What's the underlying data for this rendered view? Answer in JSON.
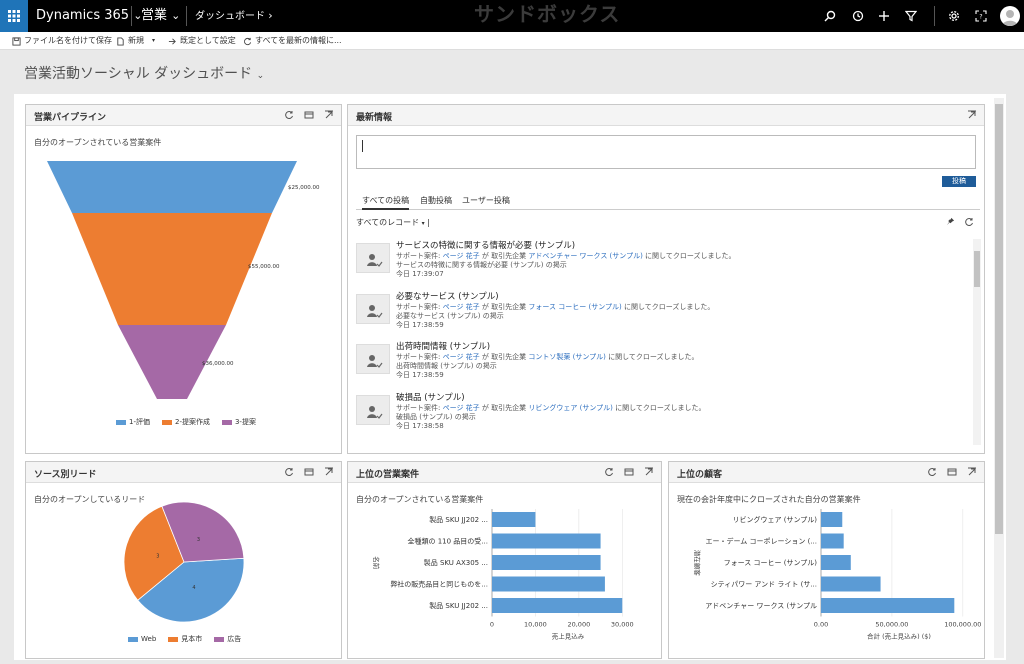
{
  "header": {
    "brand": "Dynamics 365",
    "area": "営業",
    "breadcrumb": "ダッシュボード",
    "watermark": "サンドボックス"
  },
  "commands": [
    {
      "label": "ファイル名を付けて保存",
      "icon": "save-icon"
    },
    {
      "label": "新規",
      "icon": "new-icon"
    },
    {
      "label": "既定として設定",
      "icon": "pin-default-icon"
    },
    {
      "label": "すべてを最新の情報に...",
      "icon": "refresh-icon"
    }
  ],
  "dashboard": {
    "title": "営業活動ソーシャル ダッシュボード"
  },
  "pipeline": {
    "title": "営業パイプライン",
    "subtitle": "自分のオープンされている営業案件",
    "chart_data": {
      "type": "funnel",
      "categories": [
        "1-評価",
        "2-提案作成",
        "3-提案"
      ],
      "values": [
        25000,
        55000,
        36000
      ],
      "value_labels": [
        "$25,000.00",
        "$55,000.00",
        "$36,000.00"
      ],
      "colors": [
        "#5b9bd5",
        "#ed7d31",
        "#a569a6"
      ]
    }
  },
  "feed": {
    "title": "最新情報",
    "post_button": "投稿",
    "tabs": [
      "すべての投稿",
      "自動投稿",
      "ユーザー投稿"
    ],
    "filter": "すべてのレコード",
    "items": [
      {
        "title": "サービスの特徴に関する情報が必要 (サンプル)",
        "pre": "サポート案件:",
        "user": "ページ 花子",
        "mid": "が 取引先企業",
        "account": "アドベンチャー ワークス (サンプル)",
        "post": "に関してクローズしました。",
        "line2": "サービスの特徴に関する情報が必要 (サンプル) の掲示",
        "time": "今日 17:39:07"
      },
      {
        "title": "必要なサービス (サンプル)",
        "pre": "サポート案件:",
        "user": "ページ 花子",
        "mid": "が 取引先企業",
        "account": "フォース コーヒー (サンプル)",
        "post": "に関してクローズしました。",
        "line2": "必要なサービス (サンプル) の掲示",
        "time": "今日 17:38:59"
      },
      {
        "title": "出荷時間情報 (サンプル)",
        "pre": "サポート案件:",
        "user": "ページ 花子",
        "mid": "が 取引先企業",
        "account": "コントソ製薬 (サンプル)",
        "post": "に関してクローズしました。",
        "line2": "出荷時間情報 (サンプル) の掲示",
        "time": "今日 17:38:59"
      },
      {
        "title": "破損品 (サンプル)",
        "pre": "サポート案件:",
        "user": "ページ 花子",
        "mid": "が 取引先企業",
        "account": "リビングウェア (サンプル)",
        "post": "に関してクローズしました。",
        "line2": "破損品 (サンプル) の掲示",
        "time": "今日 17:38:58"
      }
    ]
  },
  "leads": {
    "title": "ソース別リード",
    "subtitle": "自分のオープンしているリード",
    "chart_data": {
      "type": "pie",
      "categories": [
        "Web",
        "見本市",
        "広告"
      ],
      "values": [
        4,
        3,
        3
      ],
      "colors": [
        "#5b9bd5",
        "#ed7d31",
        "#a569a6"
      ]
    }
  },
  "opps": {
    "title": "上位の営業案件",
    "subtitle": "自分のオープンされている営業案件",
    "chart_data": {
      "type": "bar",
      "orientation": "horizontal",
      "categories": [
        "製品 SKU JJ202 ...",
        "全種類の 110 品目の受...",
        "製品 SKU AX305 ...",
        "弊社の販売品目と同じものを...",
        "製品 SKU JJ202 ..."
      ],
      "values": [
        10000,
        25000,
        25000,
        26000,
        30000
      ],
      "xlim": [
        0,
        35000
      ],
      "ticks": [
        "0",
        "10,000",
        "20,000",
        "30,000"
      ],
      "tick_values": [
        0,
        10000,
        20000,
        30000
      ],
      "xlabel": "売上見込み",
      "ylabel": "名前",
      "color": "#5b9bd5"
    }
  },
  "accounts": {
    "title": "上位の顧客",
    "subtitle": "現在の会計年度中にクローズされた自分の営業案件",
    "chart_data": {
      "type": "bar",
      "orientation": "horizontal",
      "categories": [
        "リビングウェア (サンプル)",
        "エー・デーム コーポレーション (...",
        "フォース コーヒー (サンプル)",
        "シティパワー アンド ライト (サ...",
        "アドベンチャー ワークス (サンプル"
      ],
      "values": [
        15000,
        16000,
        21000,
        42000,
        94000
      ],
      "xlim": [
        0,
        110000
      ],
      "ticks": [
        "0.00",
        "50,000.00",
        "100,000.00"
      ],
      "tick_values": [
        0,
        50000,
        100000
      ],
      "xlabel": "合計 (売上見込み) ($)",
      "ylabel": "潜在顧客",
      "color": "#5b9bd5"
    }
  }
}
